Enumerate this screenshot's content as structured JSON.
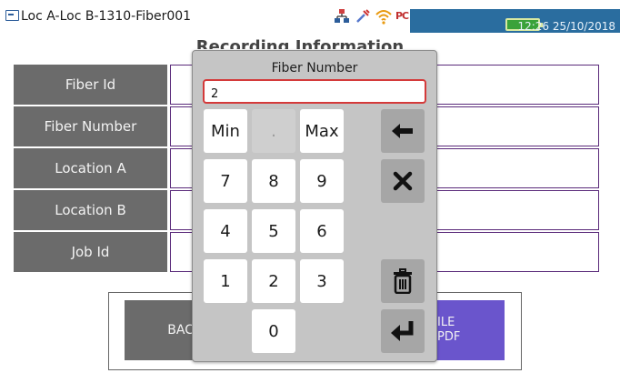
{
  "titlebar": {
    "title": "Loc A-Loc B-1310-Fiber001",
    "clock": "12:26 25/10/2018",
    "status_icons": [
      "network-icon",
      "tool-icon",
      "wifi-icon",
      "pc-link-icon",
      "battery-icon"
    ],
    "pc_label": "PC"
  },
  "page": {
    "title": "Recording Information",
    "fields": [
      {
        "label": "Fiber Id",
        "value": ""
      },
      {
        "label": "Fiber Number",
        "value": ""
      },
      {
        "label": "Location A",
        "value": ""
      },
      {
        "label": "Location B",
        "value": ""
      },
      {
        "label": "Job Id",
        "value": ""
      }
    ],
    "back_label": "BAC",
    "pdf_label_line1": "ILE",
    "pdf_label_line2": "PDF"
  },
  "keypad": {
    "title": "Fiber Number",
    "value": "2",
    "keys": {
      "min": "Min",
      "dot": ".",
      "max": "Max",
      "k7": "7",
      "k8": "8",
      "k9": "9",
      "k4": "4",
      "k5": "5",
      "k6": "6",
      "k1": "1",
      "k2": "2",
      "k3": "3",
      "k0": "0"
    },
    "actions": [
      "backspace-icon",
      "close-icon",
      "trash-icon",
      "enter-icon"
    ]
  },
  "colors": {
    "label_bg": "#6b6b6b",
    "field_border": "#5a2a7a",
    "pdf_button": "#6a55cc",
    "clock_panel": "#2a6d9f",
    "input_border": "#d43a3a",
    "battery": "#3aa23a"
  }
}
